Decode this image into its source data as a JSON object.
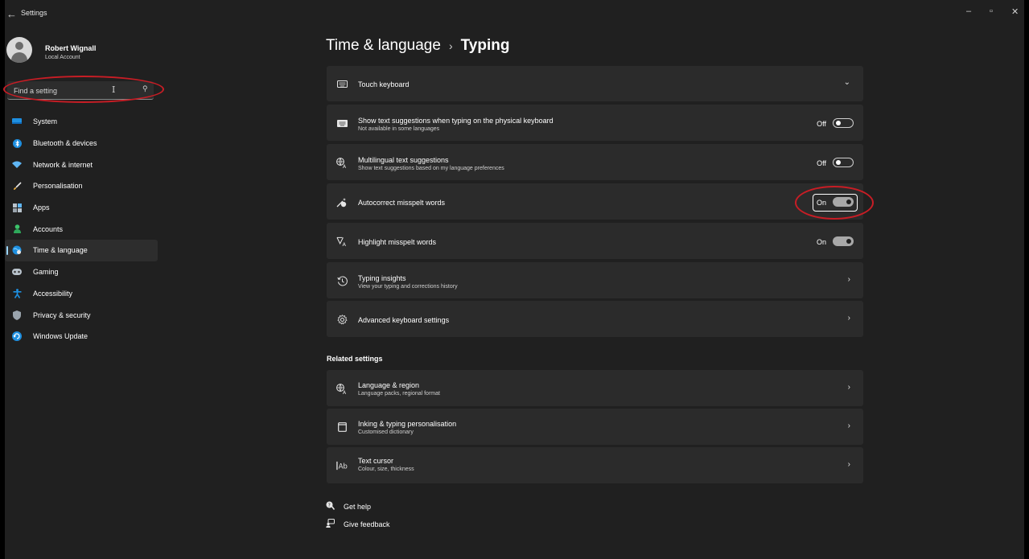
{
  "window": {
    "title": "Settings",
    "back_glyph": "←",
    "minimize_glyph": "–",
    "restore_glyph": "▫",
    "close_glyph": "✕"
  },
  "profile": {
    "name": "Robert Wignall",
    "account_type": "Local Account"
  },
  "search": {
    "placeholder": "Find a setting"
  },
  "sidebar": {
    "items": [
      {
        "label": "System",
        "icon": "monitor-icon"
      },
      {
        "label": "Bluetooth & devices",
        "icon": "bluetooth-icon"
      },
      {
        "label": "Network & internet",
        "icon": "wifi-icon"
      },
      {
        "label": "Personalisation",
        "icon": "brush-icon"
      },
      {
        "label": "Apps",
        "icon": "apps-icon"
      },
      {
        "label": "Accounts",
        "icon": "person-icon"
      },
      {
        "label": "Time & language",
        "icon": "globe-clock-icon",
        "selected": true
      },
      {
        "label": "Gaming",
        "icon": "gamepad-icon"
      },
      {
        "label": "Accessibility",
        "icon": "accessibility-icon"
      },
      {
        "label": "Privacy & security",
        "icon": "shield-icon"
      },
      {
        "label": "Windows Update",
        "icon": "update-icon"
      }
    ]
  },
  "breadcrumb": {
    "parent": "Time & language",
    "separator": "›",
    "current": "Typing"
  },
  "settings": {
    "touch_keyboard": {
      "title": "Touch keyboard",
      "icon": "keyboard-icon"
    },
    "text_suggestions": {
      "title": "Show text suggestions when typing on the physical keyboard",
      "description": "Not available in some languages",
      "state": "Off",
      "icon": "keyboard-icon"
    },
    "multilingual": {
      "title": "Multilingual text suggestions",
      "description": "Show text suggestions based on my language preferences",
      "state": "Off",
      "icon": "language-icon"
    },
    "autocorrect": {
      "title": "Autocorrect misspelt words",
      "state": "On",
      "icon": "pen-sparkle-icon"
    },
    "highlight": {
      "title": "Highlight misspelt words",
      "state": "On",
      "icon": "highlight-text-icon"
    },
    "typing_insights": {
      "title": "Typing insights",
      "description": "View your typing and corrections history",
      "icon": "history-icon"
    },
    "advanced": {
      "title": "Advanced keyboard settings",
      "icon": "gear-icon"
    }
  },
  "related": {
    "heading": "Related settings",
    "items": [
      {
        "title": "Language & region",
        "description": "Language packs, regional format",
        "icon": "language-icon"
      },
      {
        "title": "Inking & typing personalisation",
        "description": "Customised dictionary",
        "icon": "notebook-icon"
      },
      {
        "title": "Text cursor",
        "description": "Colour, size, thickness",
        "icon": "text-cursor-icon"
      }
    ]
  },
  "footer": {
    "get_help": "Get help",
    "give_feedback": "Give feedback"
  },
  "colors": {
    "background": "#202020",
    "card": "#2b2b2b",
    "accent": "#9bd6ff",
    "annotation": "#c81d25"
  }
}
